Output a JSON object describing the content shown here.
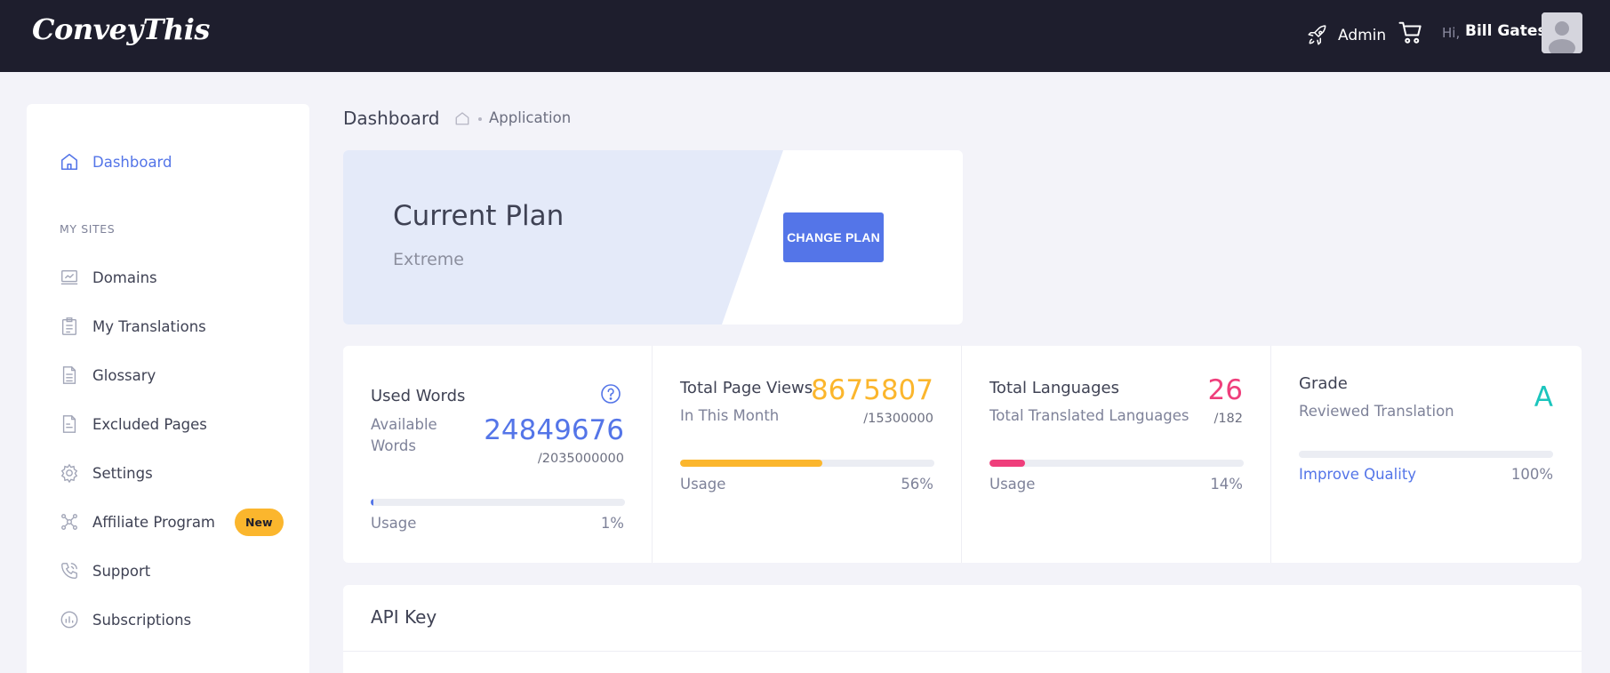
{
  "header": {
    "logo": "ConveyThis",
    "admin_label": "Admin",
    "greeting": "Hi,",
    "user_name": "Bill Gates",
    "icons": [
      "rocket-icon",
      "cart-icon",
      "avatar-icon"
    ]
  },
  "sidebar": {
    "dashboard_label": "Dashboard",
    "section_title": "MY SITES",
    "items": [
      {
        "label": "Domains",
        "icon": "laptop-chart-icon"
      },
      {
        "label": "My Translations",
        "icon": "clipboard-icon"
      },
      {
        "label": "Glossary",
        "icon": "document-icon"
      },
      {
        "label": "Excluded Pages",
        "icon": "document-excluded-icon"
      },
      {
        "label": "Settings",
        "icon": "gear-icon"
      },
      {
        "label": "Affiliate Program",
        "icon": "network-icon",
        "badge": "New"
      },
      {
        "label": "Support",
        "icon": "phone-icon"
      },
      {
        "label": "Subscriptions",
        "icon": "chart-circle-icon"
      }
    ]
  },
  "breadcrumb": {
    "title": "Dashboard",
    "current": "Application"
  },
  "plan": {
    "title": "Current Plan",
    "name": "Extreme",
    "button_label": "CHANGE PLAN"
  },
  "stats": {
    "used_words": {
      "title": "Used Words",
      "subtitle_line1": "Available",
      "subtitle_line2": "Words",
      "value": "24849676",
      "total": "/2035000000",
      "usage_label": "Usage",
      "percent": "1%",
      "fill": 0.01,
      "color": "#5475e8"
    },
    "page_views": {
      "title": "Total Page Views",
      "subtitle": "In This Month",
      "value": "8675807",
      "total": "/15300000",
      "usage_label": "Usage",
      "percent": "56%",
      "fill": 0.56,
      "color": "#fbb62d"
    },
    "languages": {
      "title": "Total Languages",
      "subtitle": "Total Translated Languages",
      "value": "26",
      "total": "/182",
      "usage_label": "Usage",
      "percent": "14%",
      "fill": 0.14,
      "color": "#ef3e7b"
    },
    "grade": {
      "title": "Grade",
      "subtitle": "Reviewed Translation",
      "value": "A",
      "link_label": "Improve Quality",
      "percent": "100%",
      "color": "#1bc5bd"
    }
  },
  "api": {
    "title": "API Key"
  },
  "colors": {
    "header_bg": "#1e1e2d",
    "accent": "#5475e8",
    "page_bg": "#f3f3f9",
    "plan_tint": "#e4eaf9"
  }
}
